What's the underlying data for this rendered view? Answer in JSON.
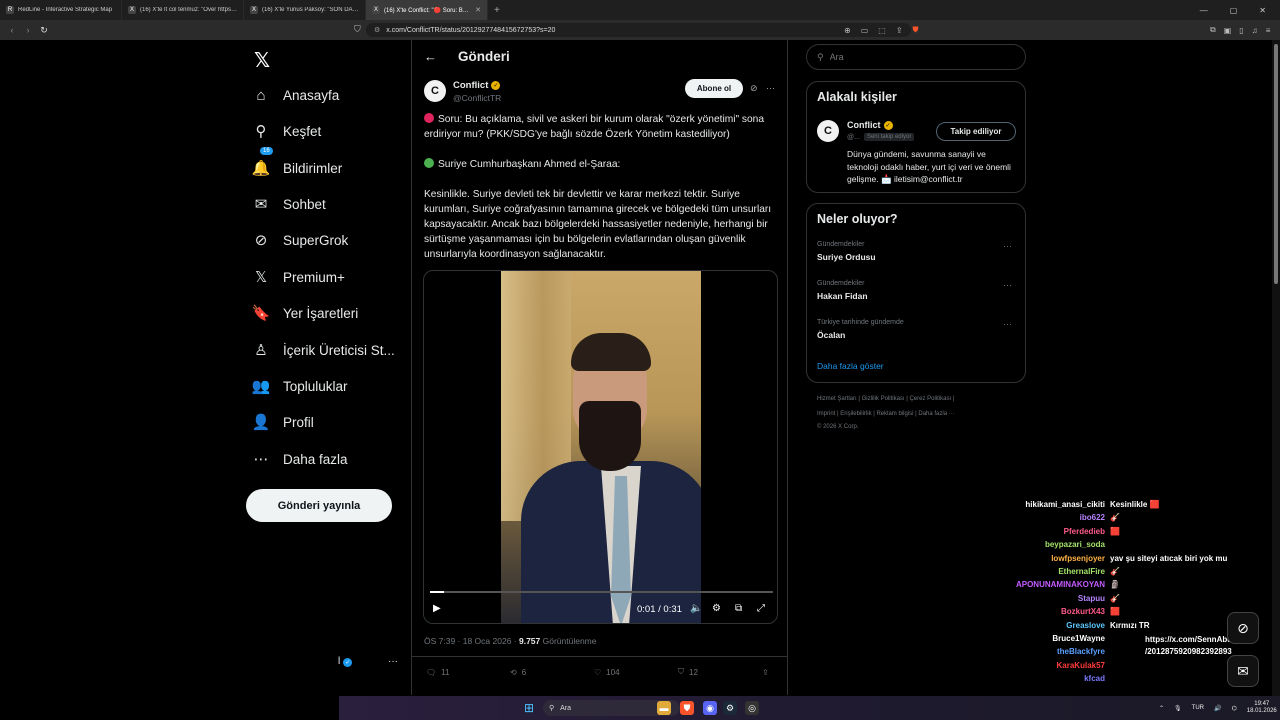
{
  "browser": {
    "tabs": [
      {
        "icon": "R",
        "title": "RedLine - Interactive Strategic Map",
        "active": false
      },
      {
        "icon": "X",
        "title": "(16) X'te lt col tenmuz: \"Over https://...",
        "active": false
      },
      {
        "icon": "X",
        "title": "(16) X'te Yunus Paksoy: \"SON DAKİKA...",
        "active": false
      },
      {
        "icon": "X",
        "title": "(16) X'te Conflict: \"🔴 Soru: Bu a...",
        "active": true
      }
    ],
    "url": "x.com/ConflictTR/status/2012927748415672753?s=20",
    "window_controls": [
      "—",
      "▢",
      "✕"
    ]
  },
  "sidebar": {
    "logo": "𝕏",
    "items": [
      {
        "label": "Anasayfa",
        "icon": "home-icon",
        "glyph": "⌂"
      },
      {
        "label": "Keşfet",
        "icon": "search-icon",
        "glyph": "⚲"
      },
      {
        "label": "Bildirimler",
        "icon": "bell-icon",
        "glyph": "🔔",
        "badge": "16"
      },
      {
        "label": "Sohbet",
        "icon": "mail-icon",
        "glyph": "✉"
      },
      {
        "label": "SuperGrok",
        "icon": "grok-icon",
        "glyph": "⊘"
      },
      {
        "label": "Premium+",
        "icon": "x-premium-icon",
        "glyph": "𝕏"
      },
      {
        "label": "Yer İşaretleri",
        "icon": "bookmark-icon",
        "glyph": "🔖"
      },
      {
        "label": "İçerik Üreticisi St...",
        "icon": "creator-studio-icon",
        "glyph": "♙"
      },
      {
        "label": "Topluluklar",
        "icon": "communities-icon",
        "glyph": "👥"
      },
      {
        "label": "Profil",
        "icon": "profile-icon",
        "glyph": "👤"
      },
      {
        "label": "Daha fazla",
        "icon": "more-circle-icon",
        "glyph": "⋯"
      }
    ],
    "post_button": "Gönderi yayınla",
    "account_fragment": "l",
    "account_more": "···"
  },
  "main": {
    "title": "Gönderi",
    "author": {
      "name": "Conflict",
      "handle": "@ConflictTR",
      "avatar_letter": "C"
    },
    "subscribe_label": "Abone ol",
    "paragraphs": [
      {
        "dot": "#e0245e",
        "text": "Soru: Bu açıklama, sivil ve askeri bir kurum olarak \"özerk yönetimi\" sona erdiriyor mu? (PKK/SDG'ye bağlı sözde Özerk Yönetim kastediliyor)"
      },
      {
        "dot": "#4caf50",
        "text": "Suriye Cumhurbaşkanı Ahmed el-Şaraa:"
      },
      {
        "dot": "",
        "text": "Kesinlikle. Suriye devleti tek bir devlettir ve karar merkezi tektir. Suriye kurumları, Suriye coğrafyasının tamamına girecek ve bölgedeki tüm unsurları kapsayacaktır. Ancak bazı bölgelerdeki hassasiyetler nedeniyle, herhangi bir sürtüşme yaşanmaması için bu bölgelerin evlatlarından oluşan güvenlik unsurlarıyla koordinasyon sağlanacaktır."
      }
    ],
    "video": {
      "time": "0:01 / 0:31",
      "progress": 0.04
    },
    "meta": {
      "time": "ÖS 7:39 · 18 Oca 2026 · ",
      "views": "9.757",
      "views_label": " Görüntülenme"
    },
    "actions": {
      "replies": "11",
      "reposts": "6",
      "likes": "104",
      "bookmarks": "12"
    }
  },
  "right": {
    "search_placeholder": "Ara",
    "related": {
      "title": "Alakalı kişiler",
      "name": "Conflict",
      "handle": "@...",
      "follows_you": "Seni takip ediyor",
      "follow_label": "Takip ediliyor",
      "bio": "Dünya gündemi, savunma sanayii ve teknoloji odaklı haber, yurt içi veri ve önemli gelişme. 📩 iletisim@conflict.tr"
    },
    "trends": {
      "title": "Neler oluyor?",
      "items": [
        {
          "category": "Gündemdekiler",
          "name": "Suriye Ordusu"
        },
        {
          "category": "Gündemdekiler",
          "name": "Hakan Fidan"
        },
        {
          "category": "Türkiye tarihinde gündemde",
          "name": "Öcalan"
        }
      ],
      "show_more": "Daha fazla göster"
    },
    "footer": {
      "line1": "Hizmet Şartları  |  Gizlilik Politikası  |  Çerez Politikası  |",
      "line2": "Imprint  |  Erişilebilirlik  |  Reklam bilgisi  |  Daha fazla ···",
      "line3": "© 2026 X Corp."
    }
  },
  "chat": [
    {
      "user": "hikikami_anasi_cikiti",
      "msg": "Kesinlikle 🟥",
      "color": "#ffffff"
    },
    {
      "user": "ibo622",
      "msg": "🎸",
      "color": "#b583ff"
    },
    {
      "user": "Pferdedieb",
      "msg": "🟥",
      "color": "#ff5a8a"
    },
    {
      "user": "beypazari_soda",
      "msg": "",
      "color": "#a5e26a"
    },
    {
      "user": "lowfpsenjoyer",
      "msg": "yav şu siteyi atıcak biri yok mu",
      "color": "#ffb347"
    },
    {
      "user": "EthernalFire",
      "msg": "🎸",
      "color": "#a5e26a"
    },
    {
      "user": "APONUNAMINAKOYAN",
      "msg": "🗿",
      "color": "#c35cff"
    },
    {
      "user": "Stapuu",
      "msg": "🎸",
      "color": "#b583ff"
    },
    {
      "user": "BozkurtX43",
      "msg": "🟥",
      "color": "#ff5a8a"
    },
    {
      "user": "Greaslove",
      "msg": "Kırmızı TR",
      "color": "#5ec8ff"
    },
    {
      "user": "Bruce1Wayne",
      "msg": "https://x.com/SennAbdulkad /2012875920982392893",
      "color": "#ffffff"
    },
    {
      "user": "theBlackfyre",
      "msg": "",
      "color": "#5aa0ff"
    },
    {
      "user": "KaraKulak57",
      "msg": "",
      "color": "#ff3b3b"
    },
    {
      "user": "kfcad",
      "msg": "",
      "color": "#7a7aff"
    }
  ],
  "taskbar": {
    "search_label": "Ara",
    "lang": "TUR",
    "time": "19:47",
    "date": "18.01.2026"
  }
}
